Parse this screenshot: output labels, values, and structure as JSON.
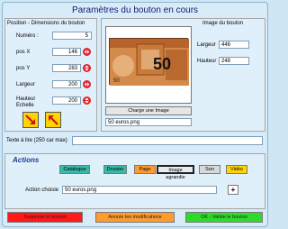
{
  "window": {
    "title": "Paramètres du bouton en cours"
  },
  "position_group": {
    "title": "Position - Dimensions du bouton",
    "numero": {
      "label": "Numéro :",
      "value": "5"
    },
    "pos_x": {
      "label": "pos X",
      "value": "146"
    },
    "pos_y": {
      "label": "pos Y",
      "value": "283"
    },
    "largeur": {
      "label": "Largeur",
      "value": "200"
    },
    "hauteur": {
      "label": "Hauteur Echelle",
      "value": "200"
    }
  },
  "image_group": {
    "title": "Image du bouton",
    "banknote_text": "50",
    "largeur": {
      "label": "Largeur",
      "value": "446"
    },
    "hauteur": {
      "label": "Hauteur",
      "value": "248"
    },
    "charge_button": "Charge une Image",
    "filename": "50 euros.png"
  },
  "text_section": {
    "label": "Texte à lire (250 car max)",
    "value": ""
  },
  "actions": {
    "title": "Actions",
    "buttons": [
      "Catalogue",
      "Dossier",
      "Page",
      "Image agrandie",
      "Son",
      "Vidéo"
    ],
    "chosen_label": "Action choisie",
    "chosen_value": "50 euros.png",
    "plus": "+"
  },
  "footer": {
    "delete": "Supprime le bouton",
    "cancel": "Annule les modifications",
    "ok": "OK - Valide le bouton"
  },
  "colors": {
    "red": "#ff1a1a",
    "orange": "#ff9a2e",
    "green": "#2fdb2a",
    "teal": "#38b8a8",
    "yellow": "#ffd400"
  }
}
